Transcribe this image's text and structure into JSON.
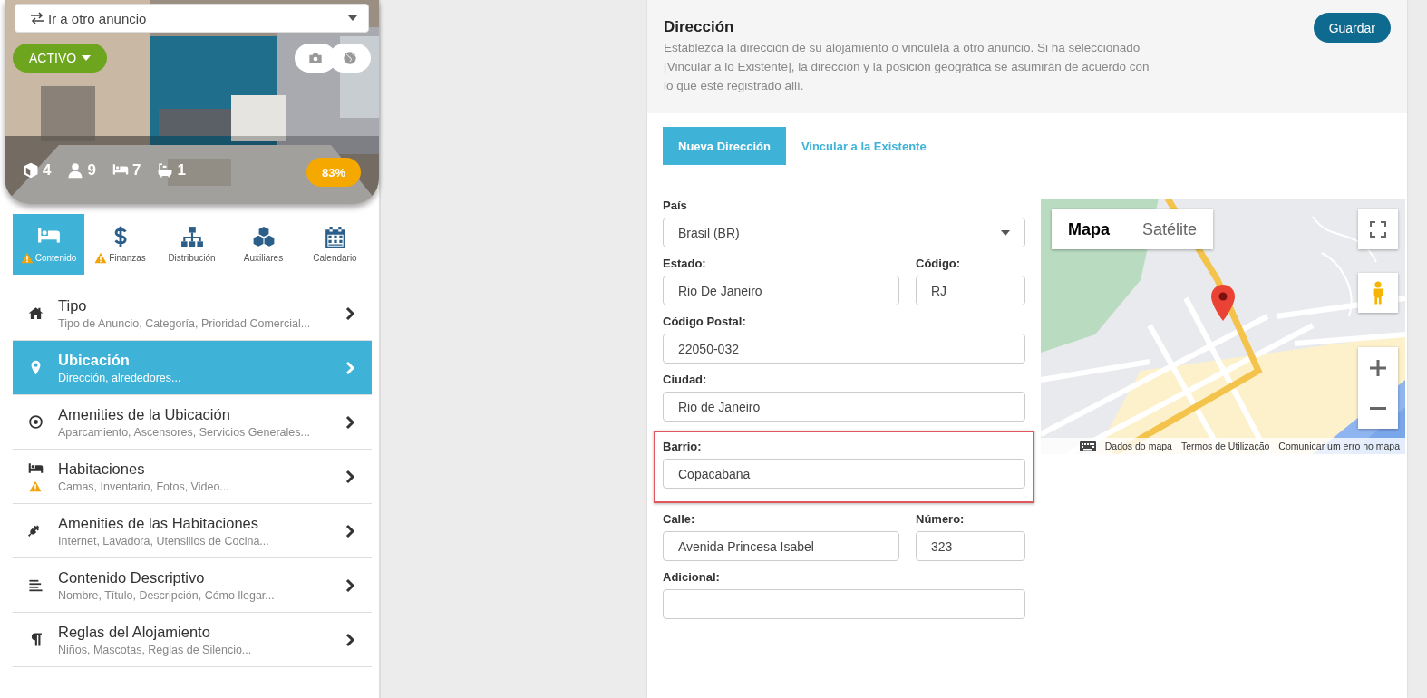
{
  "listing_switcher": {
    "label": "Ir a otro anuncio"
  },
  "listing": {
    "status": "ACTIVO",
    "completion": "83%",
    "stats": [
      {
        "kind": "units",
        "value": "4"
      },
      {
        "kind": "guests",
        "value": "9"
      },
      {
        "kind": "beds",
        "value": "7"
      },
      {
        "kind": "baths",
        "value": "1"
      }
    ]
  },
  "modules": [
    {
      "kind": "bed",
      "label": "Contenido",
      "warning": true,
      "selected": true
    },
    {
      "kind": "dollar",
      "label": "Finanzas",
      "warning": true,
      "selected": false
    },
    {
      "kind": "sitemap",
      "label": "Distribución",
      "warning": false,
      "selected": false
    },
    {
      "kind": "cubes",
      "label": "Auxiliares",
      "warning": false,
      "selected": false
    },
    {
      "kind": "calendar",
      "label": "Calendario",
      "warning": false,
      "selected": false
    }
  ],
  "sections": [
    {
      "kind": "home",
      "title": "Tipo",
      "subtitle": "Tipo de Anuncio, Categoría, Prioridad Comercial...",
      "warning": false,
      "selected": false
    },
    {
      "kind": "pin",
      "title": "Ubicación",
      "subtitle": "Dirección, alrededores...",
      "warning": false,
      "selected": true
    },
    {
      "kind": "target",
      "title": "Amenities de la Ubicación",
      "subtitle": "Aparcamiento, Ascensores, Servicios Generales...",
      "warning": false,
      "selected": false
    },
    {
      "kind": "bed",
      "title": "Habitaciones",
      "subtitle": "Camas, Inventario, Fotos, Video...",
      "warning": true,
      "selected": false
    },
    {
      "kind": "plug",
      "title": "Amenities de las Habitaciones",
      "subtitle": "Internet, Lavadora, Utensilios de Cocina...",
      "warning": false,
      "selected": false
    },
    {
      "kind": "lines",
      "title": "Contenido Descriptivo",
      "subtitle": "Nombre, Título, Descripción, Cómo llegar...",
      "warning": false,
      "selected": false
    },
    {
      "kind": "pilcrow",
      "title": "Reglas del Alojamiento",
      "subtitle": "Niños, Mascotas, Reglas de Silencio...",
      "warning": false,
      "selected": false
    }
  ],
  "panel": {
    "title": "Dirección",
    "description": "Establezca la dirección de su alojamiento o vincúlela a otro anuncio. Si ha seleccionado [Vincular a lo Existente], la dirección y la posición geográfica se asumirán de acuerdo con lo que esté registrado allí.",
    "save_button": "Guardar",
    "tabs": [
      {
        "label": "Nueva Dirección",
        "selected": true
      },
      {
        "label": "Vincular a la Existente",
        "selected": false
      }
    ],
    "field_rows": [
      [
        {
          "kind": "select",
          "label": "País",
          "value": "Brasil (BR)",
          "highlighted": false
        }
      ],
      [
        {
          "kind": "text",
          "label": "Estado:",
          "value": "Rio De Janeiro",
          "highlighted": false
        },
        {
          "kind": "text",
          "label": "Código:",
          "value": "RJ",
          "highlighted": false
        }
      ],
      [
        {
          "kind": "text",
          "label": "Código Postal:",
          "value": "22050-032",
          "highlighted": false
        }
      ],
      [
        {
          "kind": "text",
          "label": "Ciudad:",
          "value": "Rio de Janeiro",
          "highlighted": false
        }
      ],
      [
        {
          "kind": "text",
          "label": "Barrio:",
          "value": "Copacabana",
          "highlighted": true
        }
      ],
      [
        {
          "kind": "text",
          "label": "Calle:",
          "value": "Avenida Princesa Isabel",
          "highlighted": false
        },
        {
          "kind": "text",
          "label": "Número:",
          "value": "323",
          "highlighted": false
        }
      ],
      [
        {
          "kind": "text",
          "label": "Adicional:",
          "highlighted": false
        }
      ]
    ],
    "map": {
      "view_tabs": [
        {
          "label": "Mapa",
          "selected": true
        },
        {
          "label": "Satélite",
          "selected": false
        }
      ],
      "footer": [
        "Dados do mapa",
        "Termos de Utilização",
        "Comunicar um erro no mapa"
      ]
    }
  }
}
